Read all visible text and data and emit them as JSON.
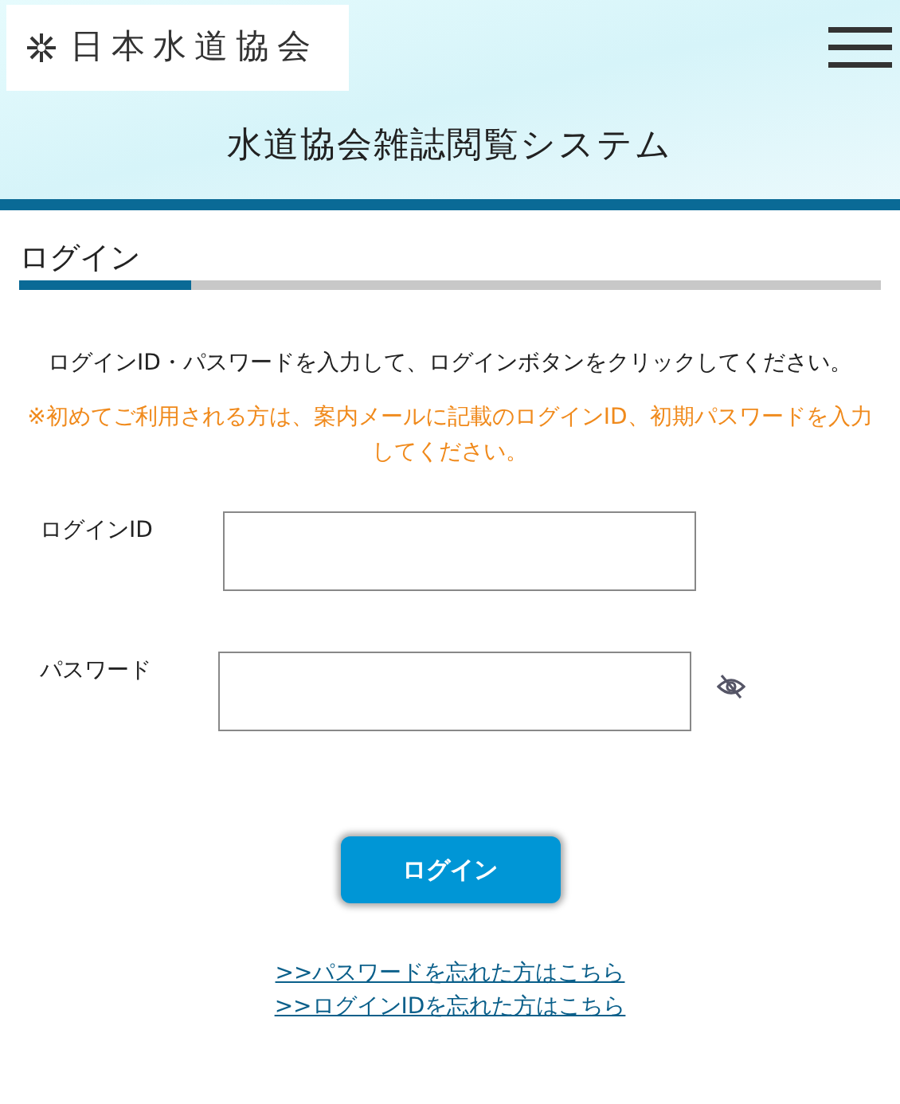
{
  "header": {
    "logo": "日本水道協会",
    "title": "水道協会雑誌閲覧システム"
  },
  "section_title": "ログイン",
  "instruction": "ログインID・パスワードを入力して、ログインボタンをクリックしてください。",
  "notice": "※初めてご利用される方は、案内メールに記載のログインID、初期パスワードを入力してください。",
  "fields": [
    {
      "label": "ログインID",
      "kind": "text"
    },
    {
      "label": "パスワード",
      "kind": "password"
    }
  ],
  "login_button": "ログイン",
  "links": [
    ">>パスワードを忘れた方はこちら",
    ">>ログインIDを忘れた方はこちら"
  ]
}
